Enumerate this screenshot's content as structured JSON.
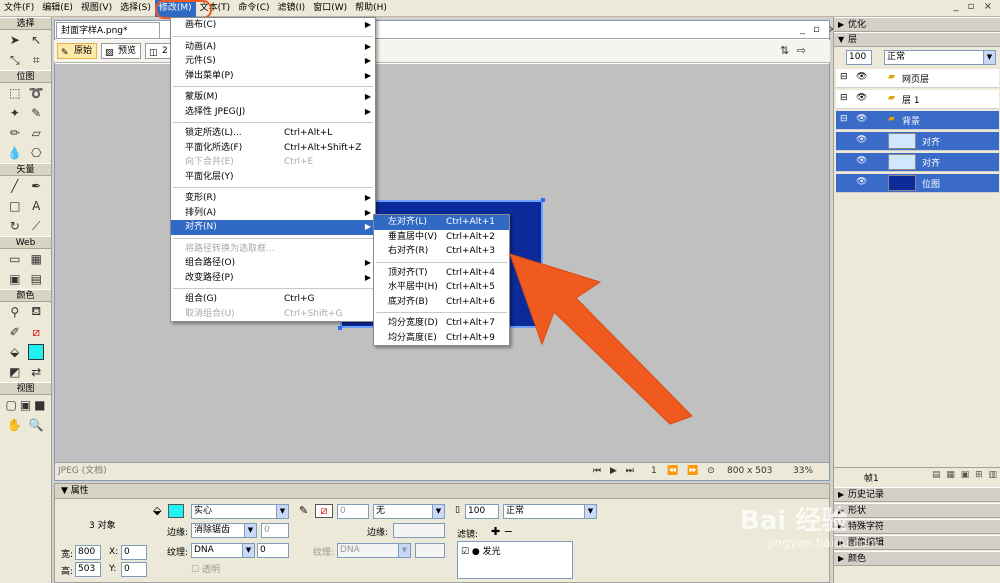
{
  "menubar": {
    "items": [
      "文件(F)",
      "编辑(E)",
      "视图(V)",
      "选择(S)",
      "修改(M)",
      "文本(T)",
      "命令(C)",
      "滤镜(I)",
      "窗口(W)",
      "帮助(H)"
    ],
    "window_controls": "_ ▫ ×"
  },
  "toolbox": {
    "sections": [
      "选择",
      "位图",
      "矢量",
      "Web",
      "颜色",
      "视图"
    ]
  },
  "document": {
    "tab_title": "封面字样A.png*",
    "view_buttons": [
      "原始",
      "预览",
      "2"
    ],
    "status_left": "JPEG (文档)",
    "page_number": "1",
    "canvas_size": "800 x 503",
    "zoom": "33%"
  },
  "modify_menu": {
    "items": [
      {
        "label": "画布(C)",
        "shortcut": "",
        "submenu": true,
        "disabled": false
      },
      {
        "sep": true
      },
      {
        "label": "动画(A)",
        "shortcut": "",
        "submenu": true,
        "disabled": false
      },
      {
        "label": "元件(S)",
        "shortcut": "",
        "submenu": true,
        "disabled": false
      },
      {
        "label": "弹出菜单(P)",
        "shortcut": "",
        "submenu": true,
        "disabled": false
      },
      {
        "sep": true
      },
      {
        "label": "蒙版(M)",
        "shortcut": "",
        "submenu": true,
        "disabled": false
      },
      {
        "label": "选择性 JPEG(J)",
        "shortcut": "",
        "submenu": true,
        "disabled": false
      },
      {
        "sep": true
      },
      {
        "label": "锁定所选(L)...",
        "shortcut": "Ctrl+Alt+L",
        "submenu": false,
        "disabled": false
      },
      {
        "label": "平面化所选(F)",
        "shortcut": "Ctrl+Alt+Shift+Z",
        "submenu": false,
        "disabled": false
      },
      {
        "label": "向下合并(E)",
        "shortcut": "Ctrl+E",
        "submenu": false,
        "disabled": true
      },
      {
        "label": "平面化层(Y)",
        "shortcut": "",
        "submenu": false,
        "disabled": false
      },
      {
        "sep": true
      },
      {
        "label": "变形(R)",
        "shortcut": "",
        "submenu": true,
        "disabled": false
      },
      {
        "label": "排列(A)",
        "shortcut": "",
        "submenu": true,
        "disabled": false
      },
      {
        "label": "对齐(N)",
        "shortcut": "",
        "submenu": true,
        "disabled": false,
        "highlight": true
      },
      {
        "sep": true
      },
      {
        "label": "将路径转换为选取框...",
        "shortcut": "",
        "submenu": false,
        "disabled": true
      },
      {
        "label": "组合路径(O)",
        "shortcut": "",
        "submenu": true,
        "disabled": false
      },
      {
        "label": "改变路径(P)",
        "shortcut": "",
        "submenu": true,
        "disabled": false
      },
      {
        "sep": true
      },
      {
        "label": "组合(G)",
        "shortcut": "Ctrl+G",
        "submenu": false,
        "disabled": false
      },
      {
        "label": "取消组合(U)",
        "shortcut": "Ctrl+Shift+G",
        "submenu": false,
        "disabled": true
      }
    ]
  },
  "align_submenu": {
    "items": [
      {
        "label": "左对齐(L)",
        "shortcut": "Ctrl+Alt+1",
        "highlight": true
      },
      {
        "label": "垂直居中(V)",
        "shortcut": "Ctrl+Alt+2"
      },
      {
        "label": "右对齐(R)",
        "shortcut": "Ctrl+Alt+3"
      },
      {
        "sep": true
      },
      {
        "label": "顶对齐(T)",
        "shortcut": "Ctrl+Alt+4"
      },
      {
        "label": "水平居中(H)",
        "shortcut": "Ctrl+Alt+5"
      },
      {
        "label": "底对齐(B)",
        "shortcut": "Ctrl+Alt+6"
      },
      {
        "sep": true
      },
      {
        "label": "均分宽度(D)",
        "shortcut": "Ctrl+Alt+7"
      },
      {
        "label": "均分高度(E)",
        "shortcut": "Ctrl+Alt+9"
      }
    ]
  },
  "properties": {
    "title": "属性",
    "object_count": "3 对象",
    "width_label": "宽:",
    "width": "800",
    "height_label": "高:",
    "height": "503",
    "x_label": "X:",
    "x": "0",
    "y_label": "Y:",
    "y": "0",
    "fill_type": "实心",
    "edge_label": "边缘:",
    "edge": "消除锯齿",
    "edge_value": "0",
    "texture_label": "纹理:",
    "texture": "DNA",
    "texture_value": "0",
    "transparent_label": "透明",
    "stroke_value": "0",
    "stroke_type": "无",
    "stroke_edge_label": "边缘:",
    "stroke_texture_label": "纹理:",
    "stroke_texture": "DNA",
    "opacity": "100",
    "blend_mode": "正常",
    "filters_label": "滤镜:",
    "filter_item": "发光",
    "fill_color": "#1ef2f2"
  },
  "right_panels": {
    "optimize": "优化",
    "layers": "层",
    "layer_opacity": "100",
    "layer_blend": "正常",
    "layer_rows": [
      {
        "name": "网页层",
        "type": "folder"
      },
      {
        "name": "层 1",
        "type": "folder"
      },
      {
        "name": "背景",
        "type": "folder",
        "selected": true
      },
      {
        "name": "对齐",
        "type": "object",
        "selected": true
      },
      {
        "name": "对齐",
        "type": "object",
        "selected": true
      },
      {
        "name": "位图",
        "type": "bitmap",
        "selected": true
      }
    ],
    "frame_label": "帧1",
    "bottom_panels": [
      "历史记录",
      "形状",
      "特殊字符",
      "图像编辑",
      "颜色"
    ]
  },
  "watermark": {
    "text": "Bai 经验",
    "url": "jingyan.baidu.com"
  },
  "colors": {
    "accent": "#316ac5",
    "arrow": "#f05a1e",
    "image_blue": "#0c2a9a"
  }
}
